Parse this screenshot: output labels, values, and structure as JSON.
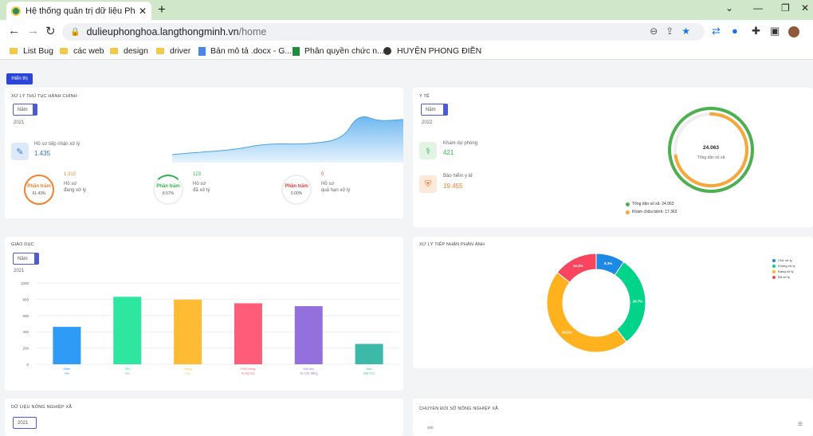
{
  "browser": {
    "tab_title": "Hệ thống quản trị dữ liệu Phong",
    "tab_close": "✕",
    "new_tab": "+",
    "url_host": "dulieuphonghoa.langthongminh.vn",
    "url_path": "/home",
    "bookmarks": [
      "List Bug",
      "các web",
      "design",
      "driver",
      "Bản mô tả .docx - G...",
      "Phân quyền chức n...",
      "HUYỆN PHONG ĐIỀN"
    ]
  },
  "toolbar": {
    "show_label": "Hiển thị"
  },
  "admin": {
    "title": "XỬ LÝ THỦ TỤC HÀNH CHÍNH",
    "filter": "Năm",
    "year": "2021",
    "received_label": "Hồ sơ tiếp nhận xử lý",
    "received_value": "1.435",
    "stats": [
      {
        "value": "1.312",
        "label1": "Hồ sơ",
        "label2": "đang xử lý",
        "ring": "Phần trăm",
        "pct": "91.43%",
        "color": "#f5812f",
        "fraction": 0.9143
      },
      {
        "value": "123",
        "label1": "Hồ sơ",
        "label2": "đã xử lý",
        "ring": "Phần trăm",
        "pct": "8.57%",
        "color": "#2eb44a",
        "fraction": 0.0857
      },
      {
        "value": "0",
        "label1": "Hồ sơ",
        "label2": "quá hạn xử lý",
        "ring": "Phần trăm",
        "pct": "0.00%",
        "color": "#e53935",
        "fraction": 0
      }
    ]
  },
  "health": {
    "title": "Y TẾ",
    "filter": "Năm",
    "year": "2022",
    "items": [
      {
        "label": "Khám dự phòng",
        "value": "421",
        "color": "#2eb44a"
      },
      {
        "label": "Bảo hiểm y tế",
        "value": "19.455",
        "color": "#f5812f"
      }
    ],
    "center_value": "24.063",
    "center_label": "Tổng dân số xã",
    "legend": [
      {
        "label": "Tổng dân số xã: 24.063",
        "color": "#4caf50"
      },
      {
        "label": "Khám chữa bệnh: 17.363",
        "color": "#f7a637"
      }
    ],
    "fractions": [
      1.0,
      0.7216
    ]
  },
  "education": {
    "title": "GIÁO DỤC",
    "filter": "Năm",
    "year": "2021"
  },
  "chart_data": [
    {
      "type": "bar",
      "categories": [
        [
          "Mầm",
          "non"
        ],
        [
          "Tiểu",
          "học"
        ],
        [
          "Trung",
          "học"
        ],
        [
          "Phổ thông",
          "trung học"
        ],
        [
          "Đại học",
          "và Cao đẳng"
        ],
        [
          "Sau",
          "Đại học"
        ]
      ],
      "values": [
        460,
        830,
        795,
        750,
        715,
        250
      ],
      "colors": [
        "#2f9bf7",
        "#2ee6a0",
        "#ffbb33",
        "#ff5c7a",
        "#9370db",
        "#3db9a9"
      ],
      "yticks": [
        0,
        200,
        400,
        600,
        800,
        1000
      ],
      "ylim": [
        0,
        1000
      ]
    },
    {
      "type": "pie",
      "title": "XỬ LÝ TIẾP NHẬN PHẢN ÁNH",
      "labels": [
        "Chờ xử lý",
        "Không xử lý",
        "Đang xử lý",
        "Đã xử lý"
      ],
      "values": [
        9.3,
        29.7,
        45.5,
        14.3
      ],
      "value_labels": [
        "9.3%",
        "29.7%",
        "45.5%",
        "14.3%"
      ],
      "colors": [
        "#1e88e5",
        "#00d48a",
        "#ffb21e",
        "#f9455e"
      ]
    }
  ],
  "agri": {
    "title": "DỮ LIỆU NÔNG NGHIỆP XÃ",
    "year": "2021"
  },
  "digital": {
    "title": "CHUYỂN ĐỔI SỐ NÔNG NGHIỆP XÃ",
    "tick": "400"
  }
}
